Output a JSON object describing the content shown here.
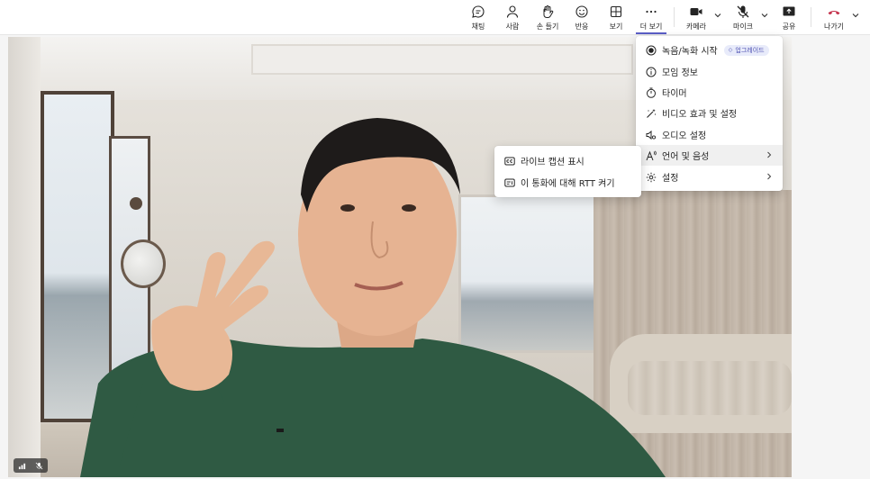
{
  "toolbar": {
    "chat": "채팅",
    "people": "사람",
    "raise_hand": "손 들기",
    "react": "반응",
    "view": "보기",
    "more": "더 보기",
    "camera": "카메라",
    "mic": "마이크",
    "share": "공유",
    "leave": "나가기"
  },
  "more_menu": {
    "items": [
      {
        "label": "녹음/녹화 시작",
        "icon": "record-icon",
        "badge": "업그레이드"
      },
      {
        "label": "모임 정보",
        "icon": "info-icon"
      },
      {
        "label": "타이머",
        "icon": "timer-icon"
      },
      {
        "label": "비디오 효과 및 설정",
        "icon": "magic-wand-icon"
      },
      {
        "label": "오디오 설정",
        "icon": "speaker-gear-icon"
      },
      {
        "label": "언어 및 음성",
        "icon": "language-icon",
        "submenu": true
      },
      {
        "label": "설정",
        "icon": "gear-icon",
        "submenu": true
      }
    ]
  },
  "language_submenu": {
    "items": [
      {
        "label": "라이브 캡션 표시",
        "icon": "cc-icon"
      },
      {
        "label": "이 통화에 대해 RTT 켜기",
        "icon": "rtt-icon"
      }
    ]
  },
  "colors": {
    "accent": "#5b5fc7",
    "leave_red": "#c4314b",
    "badge_bg": "#e8ebfa",
    "badge_text": "#4f52b2"
  }
}
